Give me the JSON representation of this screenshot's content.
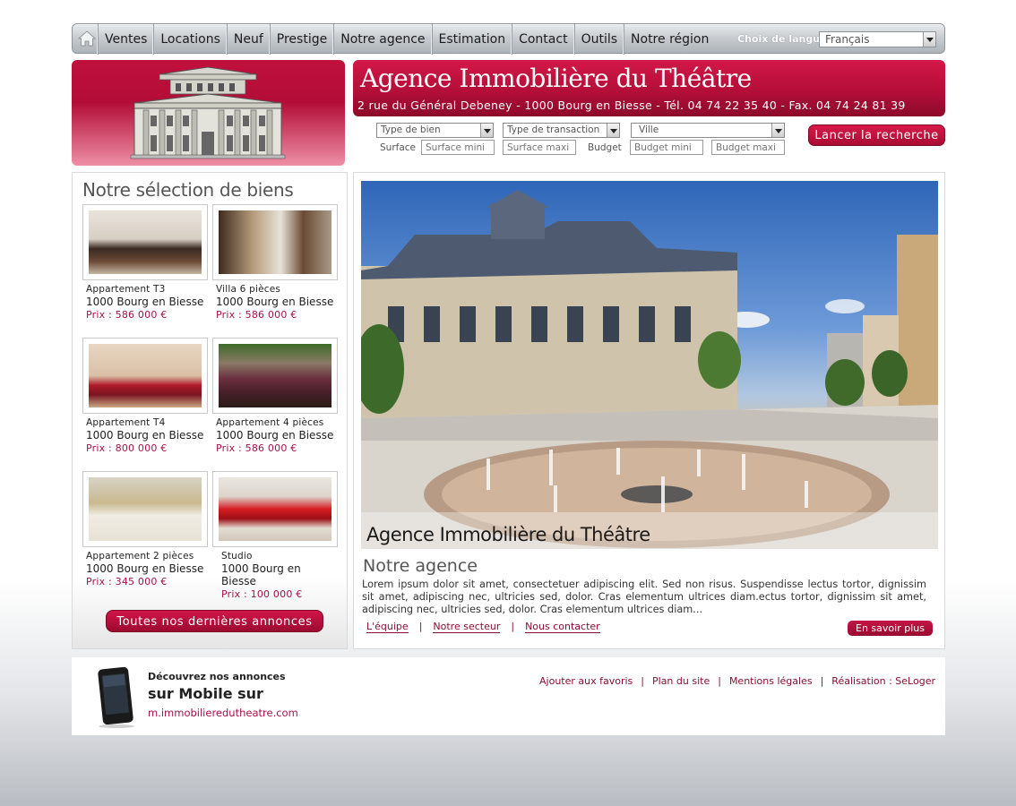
{
  "nav": {
    "items": [
      "Ventes",
      "Locations",
      "Neuf",
      "Prestige",
      "Notre agence",
      "Estimation",
      "Contact",
      "Outils",
      "Notre région"
    ],
    "lang_label": "Choix de langue",
    "lang_value": "Français"
  },
  "banner": {
    "title": "Agence Immobilière du Théâtre",
    "address": "2 rue du Général Debeney - 1000 Bourg en Biesse - Tél. 04 74 22 35 40 - Fax. 04 74 24 81 39"
  },
  "search": {
    "type_bien": "Type de bien",
    "type_transaction": "Type de transaction",
    "ville": "Ville",
    "surface_label": "Surface",
    "surface_min": "Surface mini",
    "surface_max": "Surface maxi",
    "budget_label": "Budget",
    "budget_min": "Budget mini",
    "budget_max": "Budget maxi",
    "button": "Lancer la recherche"
  },
  "selection": {
    "title": "Notre sélection de biens",
    "items": [
      {
        "type": "Appartement T3",
        "city": "1000 Bourg en Biesse",
        "price": "Prix : 586 000 €"
      },
      {
        "type": "Villa 6 pièces",
        "city": "1000 Bourg en Biesse",
        "price": "Prix : 586 000 €"
      },
      {
        "type": "Appartement T4",
        "city": "1000 Bourg en Biesse",
        "price": "Prix : 800 000 €"
      },
      {
        "type": "Appartement 4 pièces",
        "city": "1000 Bourg en Biesse",
        "price": "Prix : 586 000 €"
      },
      {
        "type": "Appartement 2 pièces",
        "city": "1000 Bourg en Biesse",
        "price": "Prix : 345 000 €"
      },
      {
        "type": "Studio",
        "city": "1000 Bourg en Biesse",
        "price": "Prix : 100 000 €"
      }
    ],
    "all_button": "Toutes nos dernières annonces"
  },
  "main": {
    "hero_caption": "Agence Immobilière du Théâtre",
    "agency_title": "Notre agence",
    "agency_text": "Lorem ipsum dolor sit amet, consectetuer adipiscing elit. Sed non risus. Suspendisse lectus tortor, dignissim sit amet, adipiscing nec, ultricies sed, dolor. Cras elementum ultrices diam.ectus tortor, dignissim sit amet, adipiscing nec, ultricies sed, dolor. Cras elementum ultrices diam...",
    "links": [
      "L'équipe",
      "Notre secteur",
      "Nous contacter"
    ],
    "more_button": "En savoir plus"
  },
  "footer": {
    "mobile_line1": "Découvrez nos annonces",
    "mobile_line2": "sur Mobile sur",
    "mobile_url": "m.immobilieredutheatre.com",
    "links": [
      "Ajouter aux favoris",
      "Plan du site",
      "Mentions légales",
      "Réalisation : SeLoger"
    ]
  },
  "colors": {
    "brand": "#b30d37",
    "link": "#8b0d33",
    "price": "#a5124a"
  },
  "icons": {
    "home": "home-icon",
    "phone": "phone-icon"
  }
}
